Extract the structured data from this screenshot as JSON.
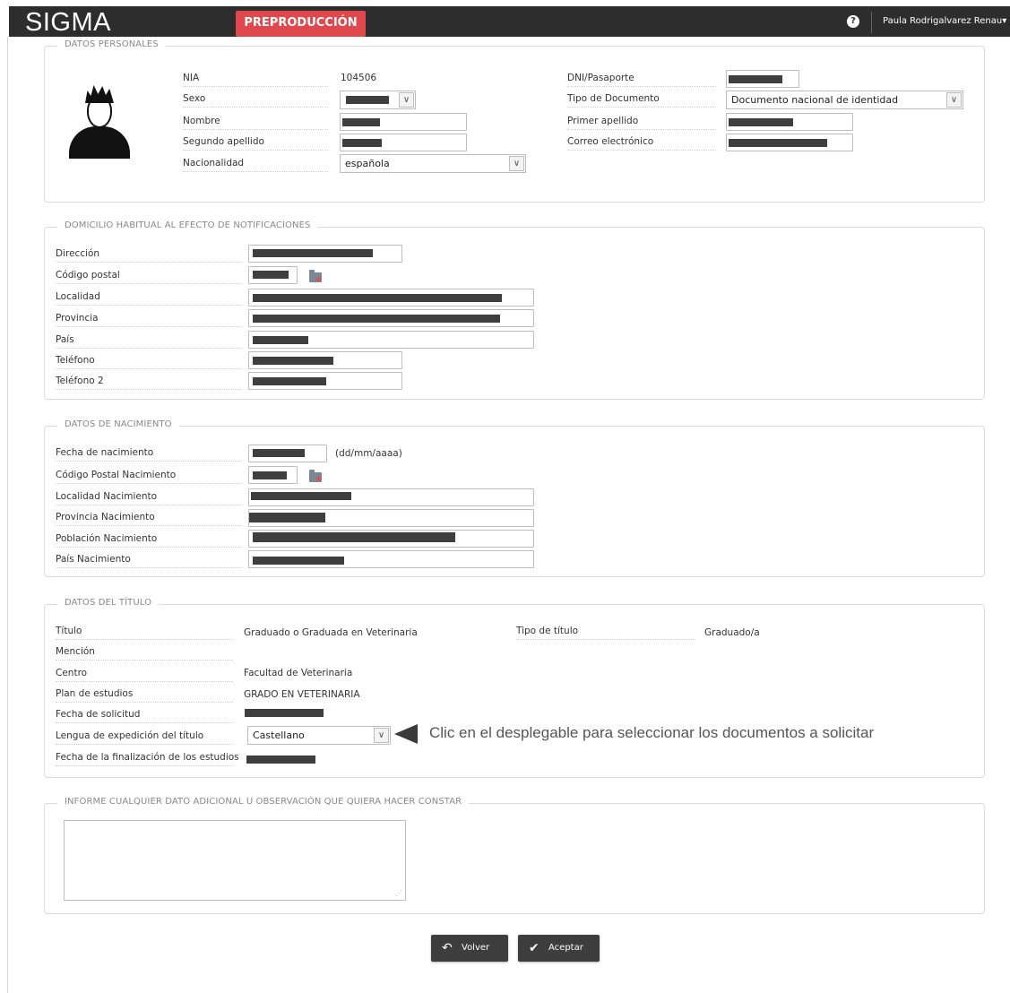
{
  "header": {
    "logo": "SIGMA",
    "environment": "PREPRODUCCIÓN",
    "help_icon": "question-circle-icon",
    "user_menu": "Paula Rodrigalvarez Renau▾"
  },
  "personal": {
    "legend": "DATOS PERSONALES",
    "avatar_icon": "user-avatar-icon",
    "nia_label": "NIA",
    "nia_value": "104506",
    "sexo_label": "Sexo",
    "nombre_label": "Nombre",
    "segundo_apellido_label": "Segundo apellido",
    "nacionalidad_label": "Nacionalidad",
    "nacionalidad_value": "española",
    "dni_label": "DNI/Pasaporte",
    "tipo_doc_label": "Tipo de Documento",
    "tipo_doc_value": "Documento nacional de identidad",
    "primer_apellido_label": "Primer apellido",
    "correo_label": "Correo electrónico"
  },
  "domicilio": {
    "legend": "DOMICILIO HABITUAL AL EFECTO DE NOTIFICACIONES",
    "direccion_label": "Dirección",
    "cp_label": "Código postal",
    "localidad_label": "Localidad",
    "provincia_label": "Provincia",
    "pais_label": "País",
    "telefono_label": "Teléfono",
    "telefono2_label": "Teléfono 2"
  },
  "nacimiento": {
    "legend": "DATOS DE NACIMIENTO",
    "fecha_label": "Fecha de nacimiento",
    "fecha_hint": "(dd/mm/aaaa)",
    "cp_label": "Código Postal Nacimiento",
    "localidad_label": "Localidad Nacimiento",
    "provincia_label": "Provincia Nacimiento",
    "poblacion_label": "Población Nacimiento",
    "pais_label": "País Nacimiento"
  },
  "titulo": {
    "legend": "DATOS DEL TÍTULO",
    "titulo_label": "Título",
    "titulo_value": "Graduado o Graduada en Veterinaria",
    "tipo_label": "Tipo de título",
    "tipo_value": "Graduado/a",
    "mencion_label": "Mención",
    "centro_label": "Centro",
    "centro_value": "Facultad de Veterinaria",
    "plan_label": "Plan de estudios",
    "plan_value": "GRADO EN VETERINARIA",
    "fecha_solicitud_label": "Fecha de solicitud",
    "lengua_label": "Lengua de expedición del título",
    "lengua_value": "Castellano",
    "fecha_fin_label": "Fecha de la finalización de los estudios"
  },
  "observaciones": {
    "legend": "INFORME CUALQUIER DATO ADICIONAL U OBSERVACIÓN QUE QUIERA HACER CONSTAR"
  },
  "annotation": "Clic en el desplegable para seleccionar los documentos a solicitar",
  "buttons": {
    "volver": "Volver",
    "volver_icon": "undo-arrow-icon",
    "aceptar": "Aceptar",
    "aceptar_icon": "checkmark-icon"
  }
}
